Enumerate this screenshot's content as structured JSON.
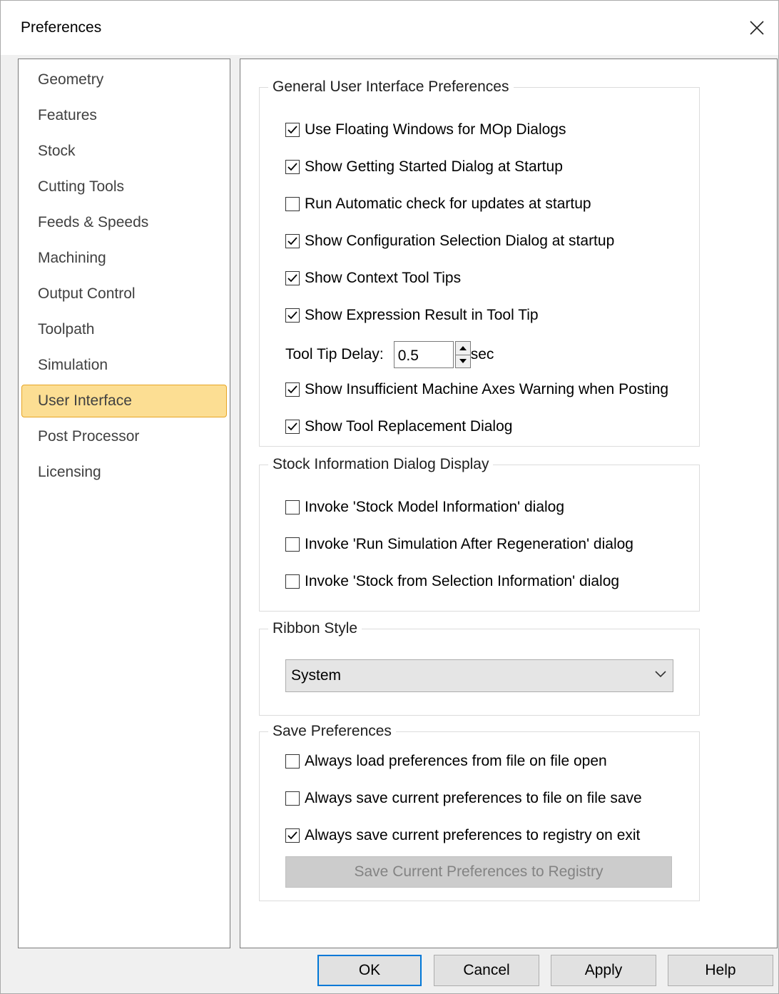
{
  "window": {
    "title": "Preferences",
    "close_icon": "close-icon"
  },
  "sidebar": {
    "items": [
      {
        "label": "Geometry"
      },
      {
        "label": "Features"
      },
      {
        "label": "Stock"
      },
      {
        "label": "Cutting Tools"
      },
      {
        "label": "Feeds & Speeds"
      },
      {
        "label": "Machining"
      },
      {
        "label": "Output Control"
      },
      {
        "label": "Toolpath"
      },
      {
        "label": "Simulation"
      },
      {
        "label": "User Interface",
        "selected": true
      },
      {
        "label": "Post Processor"
      },
      {
        "label": "Licensing"
      }
    ]
  },
  "general": {
    "title": "General User Interface Preferences",
    "options": [
      {
        "label": "Use Floating Windows for MOp Dialogs",
        "checked": true
      },
      {
        "label": "Show Getting Started Dialog at Startup",
        "checked": true
      },
      {
        "label": "Run Automatic check for updates at startup",
        "checked": false
      },
      {
        "label": "Show Configuration Selection Dialog at startup",
        "checked": true
      },
      {
        "label": "Show Context Tool Tips",
        "checked": true
      },
      {
        "label": "Show Expression Result in Tool Tip",
        "checked": true
      },
      {
        "label": "Show Insufficient Machine Axes Warning when Posting",
        "checked": true
      },
      {
        "label": "Show Tool Replacement Dialog",
        "checked": true
      }
    ],
    "tooltip_delay": {
      "label": "Tool Tip Delay:",
      "value": "0.5",
      "unit": "sec"
    }
  },
  "stock_info": {
    "title": "Stock Information Dialog Display",
    "options": [
      {
        "label": "Invoke 'Stock Model Information' dialog",
        "checked": false
      },
      {
        "label": "Invoke 'Run Simulation After Regeneration' dialog",
        "checked": false
      },
      {
        "label": "Invoke 'Stock from Selection Information' dialog",
        "checked": false
      }
    ]
  },
  "ribbon": {
    "title": "Ribbon Style",
    "selected": "System"
  },
  "save_prefs": {
    "title": "Save Preferences",
    "options": [
      {
        "label": "Always load preferences from file on file open",
        "checked": false
      },
      {
        "label": "Always save current preferences to file on file save",
        "checked": false
      },
      {
        "label": "Always save current preferences to registry on exit",
        "checked": true
      }
    ],
    "save_button": "Save Current Preferences to Registry"
  },
  "footer": {
    "ok": "OK",
    "cancel": "Cancel",
    "apply": "Apply",
    "help": "Help"
  },
  "colors": {
    "selection_fill": "#fcde93",
    "selection_border": "#e6a525",
    "default_button_border": "#0078d7"
  }
}
